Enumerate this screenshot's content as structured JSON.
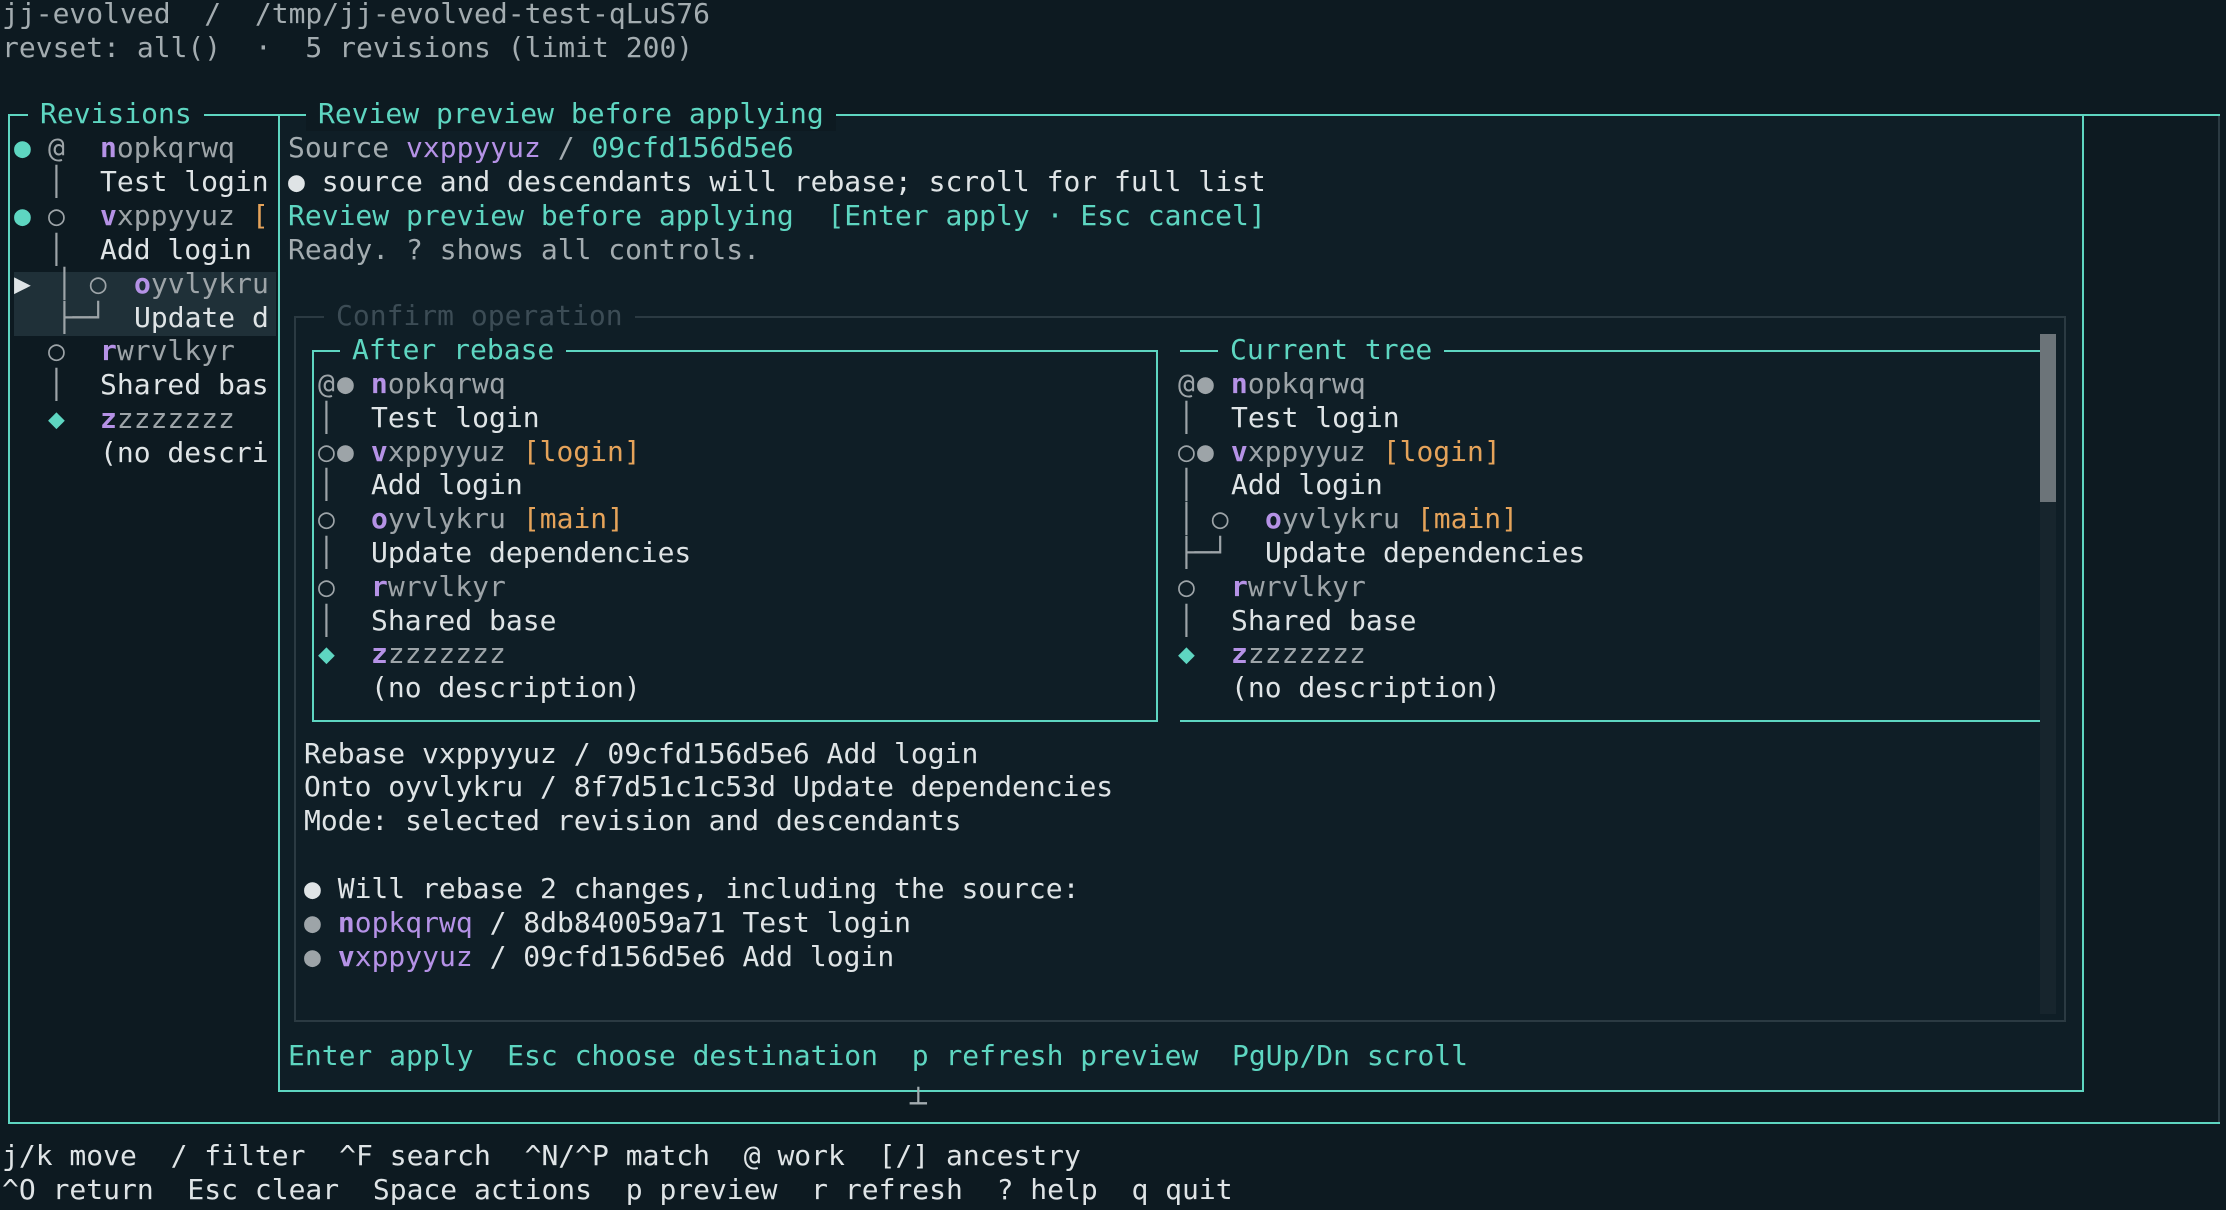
{
  "header": {
    "path": "jj-evolved  /  /tmp/jj-evolved-test-qLuS76",
    "revset": "revset: all()  ·  5 revisions (limit 200)"
  },
  "revisions_panel": {
    "title": "Revisions",
    "rows": [
      {
        "marker": "●",
        "node": "@",
        "id_head": "n",
        "id_tail": "opkqrwq",
        "extra": ""
      },
      {
        "marker": "",
        "node": "│",
        "id_head": "",
        "id_tail": "Test login",
        "extra": ""
      },
      {
        "marker": "●",
        "node": "○",
        "id_head": "v",
        "id_tail": "xppyyuz",
        "extra": "["
      },
      {
        "marker": "",
        "node": "│",
        "id_head": "",
        "id_tail": "Add login",
        "extra": ""
      },
      {
        "marker": "▶",
        "node": "│ ○",
        "id_head": "o",
        "id_tail": "yvlykru",
        "extra": ""
      },
      {
        "marker": "",
        "node": "├─┘",
        "id_head": "",
        "id_tail": "Update d",
        "extra": ""
      },
      {
        "marker": "",
        "node": "○",
        "id_head": "r",
        "id_tail": "wrvlkyr",
        "extra": ""
      },
      {
        "marker": "",
        "node": "│",
        "id_head": "",
        "id_tail": "Shared bas",
        "extra": ""
      },
      {
        "marker": "",
        "node": "◆",
        "id_head": "z",
        "id_tail": "zzzzzzz",
        "extra": ""
      },
      {
        "marker": "",
        "node": "",
        "id_head": "",
        "id_tail": "(no descri",
        "extra": ""
      }
    ]
  },
  "review": {
    "title": "Review preview before applying",
    "source_label": "Source",
    "source_id": "vxppyyuz",
    "source_sep": " / ",
    "source_hash": "09cfd156d5e6",
    "notice": "● source and descendants will rebase; scroll for full list",
    "status_title": "Review preview before applying",
    "status_keys": "[Enter apply · Esc cancel]",
    "ready": "Ready. ? shows all controls.",
    "confirm_title": "Confirm operation",
    "after_title": "After rebase",
    "current_title": "Current tree",
    "after_rows": [
      {
        "graph": "@",
        "dot": "●",
        "id_head": "n",
        "id_tail": "opkqrwq",
        "bookmark": ""
      },
      {
        "graph": "│",
        "dot": "",
        "id_head": "",
        "id_tail": "Test login",
        "bookmark": ""
      },
      {
        "graph": "○",
        "dot": "●",
        "id_head": "v",
        "id_tail": "xppyyuz",
        "bookmark": "[login]"
      },
      {
        "graph": "│",
        "dot": "",
        "id_head": "",
        "id_tail": "Add login",
        "bookmark": ""
      },
      {
        "graph": "○",
        "dot": "",
        "id_head": "o",
        "id_tail": "yvlykru",
        "bookmark": "[main]"
      },
      {
        "graph": "│",
        "dot": "",
        "id_head": "",
        "id_tail": "Update dependencies",
        "bookmark": ""
      },
      {
        "graph": "○",
        "dot": "",
        "id_head": "r",
        "id_tail": "wrvlkyr",
        "bookmark": ""
      },
      {
        "graph": "│",
        "dot": "",
        "id_head": "",
        "id_tail": "Shared base",
        "bookmark": ""
      },
      {
        "graph": "◆",
        "dot": "",
        "id_head": "z",
        "id_tail": "zzzzzzz",
        "bookmark": ""
      },
      {
        "graph": "",
        "dot": "",
        "id_head": "",
        "id_tail": "(no description)",
        "bookmark": ""
      }
    ],
    "current_rows": [
      {
        "graph": "@",
        "dot": "●",
        "id_head": "n",
        "id_tail": "opkqrwq",
        "bookmark": ""
      },
      {
        "graph": "│",
        "dot": "",
        "id_head": "",
        "id_tail": "Test login",
        "bookmark": ""
      },
      {
        "graph": "○",
        "dot": "●",
        "id_head": "v",
        "id_tail": "xppyyuz",
        "bookmark": "[login]"
      },
      {
        "graph": "│",
        "dot": "",
        "id_head": "",
        "id_tail": "Add login",
        "bookmark": ""
      },
      {
        "graph": "│ ○",
        "dot": "",
        "id_head": "o",
        "id_tail": "yvlykru",
        "bookmark": "[main]"
      },
      {
        "graph": "├─┘",
        "dot": "",
        "id_head": "",
        "id_tail": "Update dependencies",
        "bookmark": ""
      },
      {
        "graph": "○",
        "dot": "",
        "id_head": "r",
        "id_tail": "wrvlkyr",
        "bookmark": ""
      },
      {
        "graph": "│",
        "dot": "",
        "id_head": "",
        "id_tail": "Shared base",
        "bookmark": ""
      },
      {
        "graph": "◆",
        "dot": "",
        "id_head": "z",
        "id_tail": "zzzzzzz",
        "bookmark": ""
      },
      {
        "graph": "",
        "dot": "",
        "id_head": "",
        "id_tail": "(no description)",
        "bookmark": ""
      }
    ],
    "details": [
      "Rebase vxppyyuz / 09cfd156d5e6 Add login",
      "Onto oyvlykru / 8f7d51c1c53d Update dependencies",
      "Mode: selected revision and descendants"
    ],
    "changes_header": "● Will rebase 2 changes, including the source:",
    "changes": [
      {
        "bullet": "●",
        "id_head": "n",
        "id_tail": "opkqrwq",
        "rest": " / 8db840059a71 Test login"
      },
      {
        "bullet": "●",
        "id_head": "v",
        "id_tail": "xppyyuz",
        "rest": " / 09cfd156d5e6 Add login"
      }
    ],
    "footer_keys": "Enter apply  Esc choose destination  p refresh preview  PgUp/Dn scroll"
  },
  "bottom_help": {
    "line1": "j/k move  / filter  ^F search  ^N/^P match  @ work  [/] ancestry",
    "line2": "^O return  Esc clear  Space actions  p preview  r refresh  ? help  q quit"
  },
  "colors": {
    "background": "#0d1a21",
    "accent_teal": "#5ed6c1",
    "bookmark_orange": "#e5a35a",
    "id_violet": "#b592e6"
  }
}
